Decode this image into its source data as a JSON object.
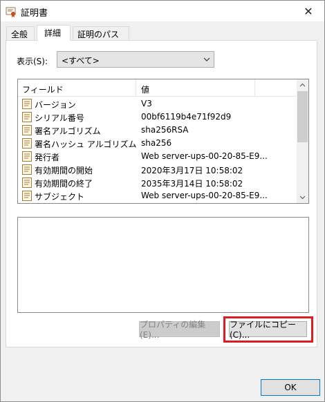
{
  "window": {
    "title": "証明書",
    "icon": "certificate-icon",
    "close_glyph": "✕"
  },
  "tabs": [
    {
      "label": "全般",
      "active": false
    },
    {
      "label": "詳細",
      "active": true
    },
    {
      "label": "証明のパス",
      "active": false
    }
  ],
  "details": {
    "show_label": "表示(S):",
    "show_value": "<すべて>",
    "columns": [
      "フィールド",
      "値"
    ],
    "rows": [
      {
        "field": "バージョン",
        "value": "V3"
      },
      {
        "field": "シリアル番号",
        "value": "00bf6119b4e71f92d9"
      },
      {
        "field": "署名アルゴリズム",
        "value": "sha256RSA"
      },
      {
        "field": "署名ハッシュ アルゴリズム",
        "value": "sha256"
      },
      {
        "field": "発行者",
        "value": "Web server-ups-00-20-85-E9..."
      },
      {
        "field": "有効期間の開始",
        "value": "2020年3月17日 10:58:02"
      },
      {
        "field": "有効期間の終了",
        "value": "2035年3月14日 10:58:02"
      },
      {
        "field": "サブジェクト",
        "value": "Web server-ups-00-20-85-E9..."
      }
    ],
    "details_text": ""
  },
  "buttons": {
    "properties": "プロパティの編集(E)...",
    "copy_to_file": "ファイルにコピー(C)...",
    "ok": "OK"
  },
  "colors": {
    "highlight": "#e01a22",
    "ok_border": "#0078d7"
  }
}
